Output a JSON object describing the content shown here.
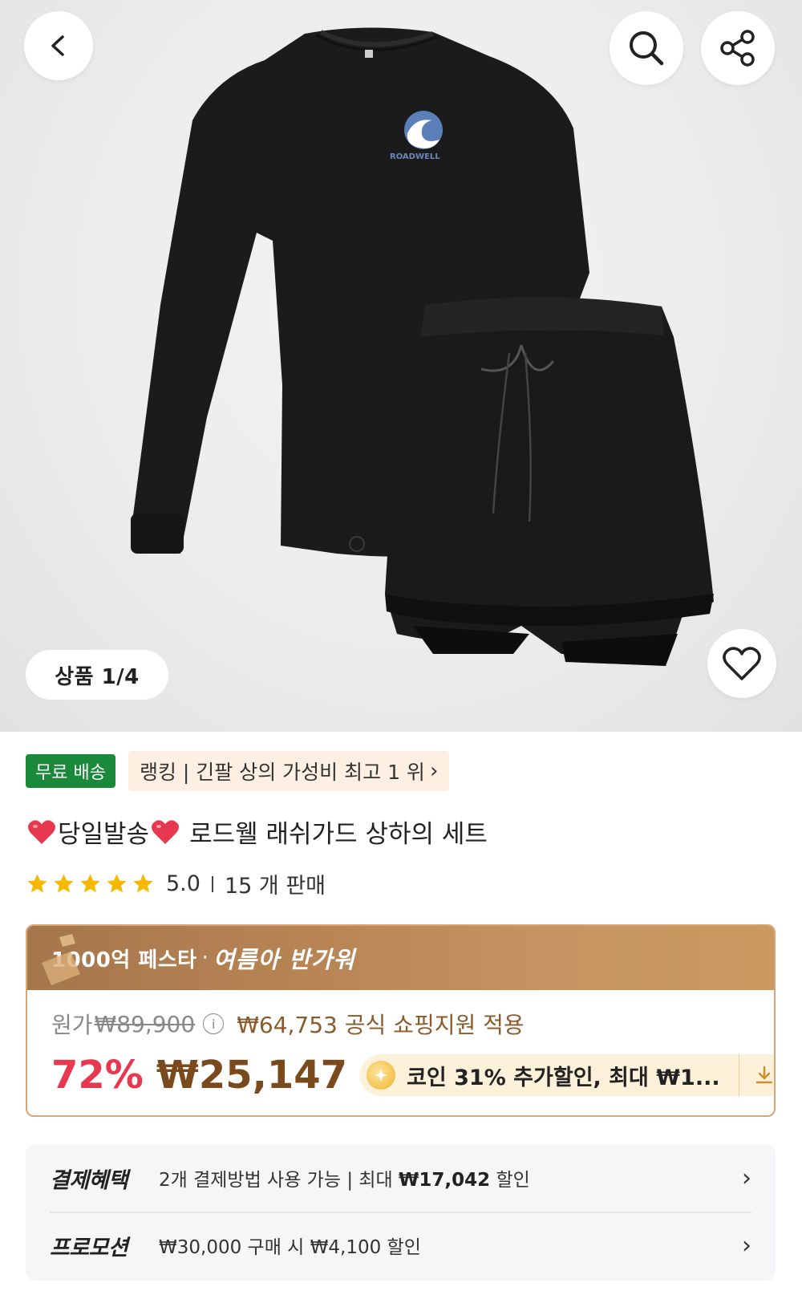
{
  "hero": {
    "page_indicator": "상품 1/4",
    "icons": [
      "back-arrow-icon",
      "search-icon",
      "share-icon",
      "heart-outline-icon"
    ],
    "shirt_logo_text": "ROADWELL"
  },
  "tags": {
    "free_shipping": "무료 배송",
    "ranking": "랭킹 | 긴팔 상의 가성비 최고 1 위"
  },
  "product": {
    "title": "당일발송 로드웰 래쉬가드 상하의 세트",
    "title_prefix": "당일발송",
    "title_main": "로드웰 래쉬가드 상하의 세트",
    "rating": "5.0",
    "stars": 5,
    "sales": "15 개 판매"
  },
  "price": {
    "promo_fest": "1000억 페스타",
    "promo_dot": "·",
    "promo_summer": "여름아 반가워",
    "original_label": "원가",
    "original_price": "₩89,900",
    "support_text": "₩64,753 공식 쇼핑지원 적용",
    "discount": "72%",
    "final_price": "₩25,147",
    "coin_text": "코인 31% 추가할인, 최대 ₩1..."
  },
  "benefits": {
    "payment_label": "결제혜택",
    "payment_desc_a": "2개 결제방법 사용 가능 | 최대 ",
    "payment_desc_b": "₩17,042",
    "payment_desc_c": " 할인",
    "promo_label": "프로모션",
    "promo_desc": "₩30,000 구매 시 ₩4,100 할인"
  },
  "colors": {
    "free_tag": "#1a8a3a",
    "discount": "#e8384f",
    "price": "#7a4a1c",
    "promo_band": "#b98554",
    "star": "#f7b900"
  }
}
